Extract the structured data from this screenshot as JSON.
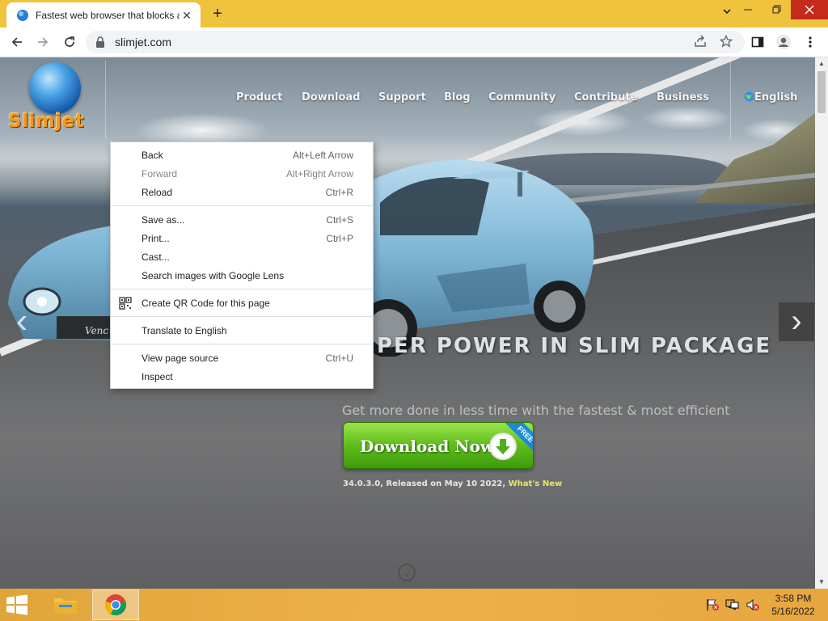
{
  "browser": {
    "tab_title": "Fastest web browser that blocks ads",
    "tab_close": "✕",
    "new_tab": "+",
    "url": "slimjet.com",
    "colors": {
      "frame": "#f0c33c",
      "close_button": "#c42b1c"
    }
  },
  "site": {
    "logo_text": "Slimjet",
    "nav": {
      "product": "Product",
      "download": "Download",
      "support": "Support",
      "blog": "Blog",
      "community": "Community",
      "contribute": "Contribute",
      "business": "Business"
    },
    "language": "English",
    "headline": "PER POWER IN SLIM PACKAGE",
    "subline": "Get more done in less time with the fastest & most efficient browser.",
    "download_button": "Download Now",
    "free_ribbon": "FREE",
    "version_text": "34.0.3.0, Released on May 10 2022, ",
    "whats_new": "What's New",
    "colors": {
      "download_green": "#5fbd1a",
      "logo_orange": "#f39a1b",
      "whats_new": "#e9e76a"
    }
  },
  "context_menu": {
    "back": {
      "label": "Back",
      "shortcut": "Alt+Left Arrow"
    },
    "forward": {
      "label": "Forward",
      "shortcut": "Alt+Right Arrow"
    },
    "reload": {
      "label": "Reload",
      "shortcut": "Ctrl+R"
    },
    "save_as": {
      "label": "Save as...",
      "shortcut": "Ctrl+S"
    },
    "print": {
      "label": "Print...",
      "shortcut": "Ctrl+P"
    },
    "cast": {
      "label": "Cast..."
    },
    "search_lens": {
      "label": "Search images with Google Lens"
    },
    "qr_code": {
      "label": "Create QR Code for this page"
    },
    "translate": {
      "label": "Translate to English"
    },
    "view_source": {
      "label": "View page source",
      "shortcut": "Ctrl+U"
    },
    "inspect": {
      "label": "Inspect"
    }
  },
  "taskbar": {
    "time": "3:58 PM",
    "date": "5/16/2022"
  }
}
